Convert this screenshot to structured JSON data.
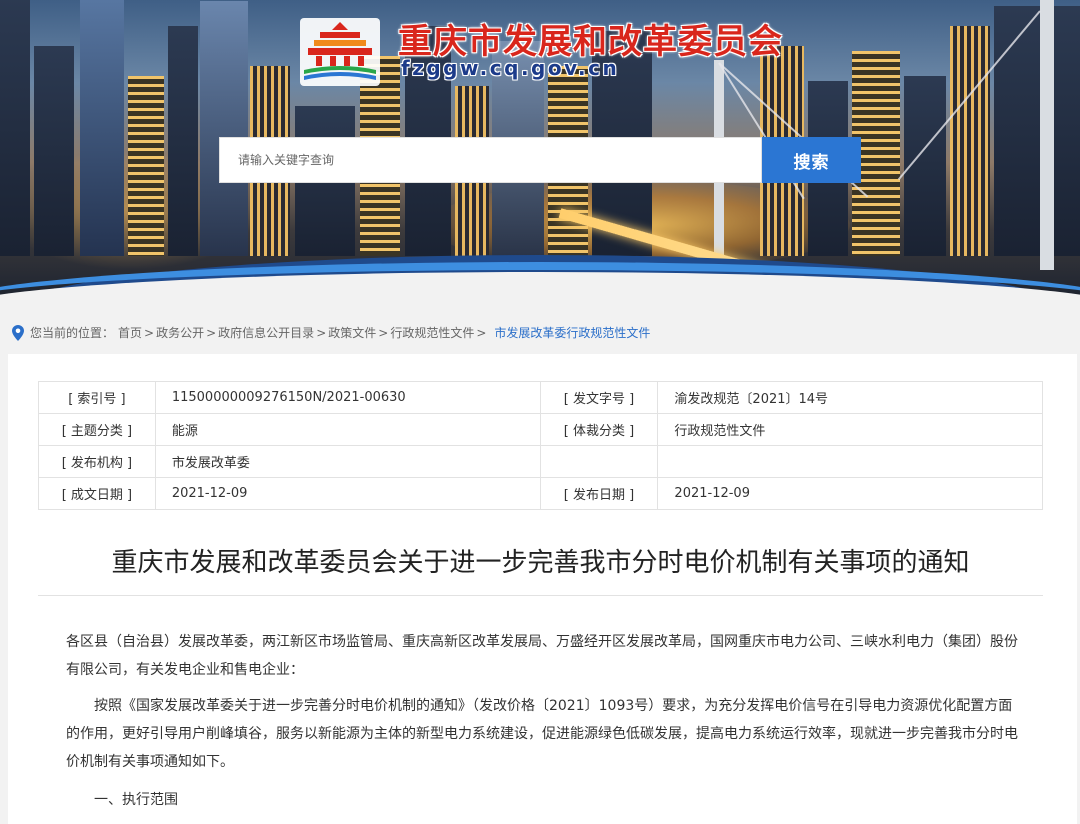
{
  "header": {
    "site_title": "重庆市发展和改革委员会",
    "site_url": "fzggw.cq.gov.cn"
  },
  "search": {
    "placeholder": "请输入关键字查询",
    "button_label": "搜索"
  },
  "breadcrumb": {
    "prefix": "您当前的位置：",
    "items": [
      "首页",
      "政务公开",
      "政府信息公开目录",
      "政策文件",
      "行政规范性文件"
    ],
    "current": "市发展改革委行政规范性文件"
  },
  "meta": {
    "rows": [
      {
        "l1": "[ 索引号 ]",
        "v1": "11500000009276150N/2021-00630",
        "l2": "[ 发文字号 ]",
        "v2": "渝发改规范〔2021〕14号"
      },
      {
        "l1": "[ 主题分类 ]",
        "v1": "能源",
        "l2": "[ 体裁分类 ]",
        "v2": "行政规范性文件"
      },
      {
        "l1": "[ 发布机构 ]",
        "v1": "市发展改革委",
        "l2": "",
        "v2": ""
      },
      {
        "l1": "[ 成文日期 ]",
        "v1": "2021-12-09",
        "l2": "[ 发布日期 ]",
        "v2": "2021-12-09"
      }
    ]
  },
  "document": {
    "title": "重庆市发展和改革委员会关于进一步完善我市分时电价机制有关事项的通知",
    "paragraphs": [
      "各区县（自治县）发展改革委，两江新区市场监管局、重庆高新区改革发展局、万盛经开区发展改革局，国网重庆市电力公司、三峡水利电力（集团）股份有限公司，有关发电企业和售电企业：",
      "按照《国家发展改革委关于进一步完善分时电价机制的通知》（发改价格〔2021〕1093号）要求，为充分发挥电价信号在引导电力资源优化配置方面的作用，更好引导用户削峰填谷，服务以新能源为主体的新型电力系统建设，促进能源绿色低碳发展，提高电力系统运行效率，现就进一步完善我市分时电价机制有关事项通知如下。",
      "一、执行范围"
    ]
  },
  "colors": {
    "title_red": "#d9261c",
    "url_blue": "#1c3b8a",
    "search_button": "#2b76d3",
    "breadcrumb_current": "#2b6fc9"
  }
}
